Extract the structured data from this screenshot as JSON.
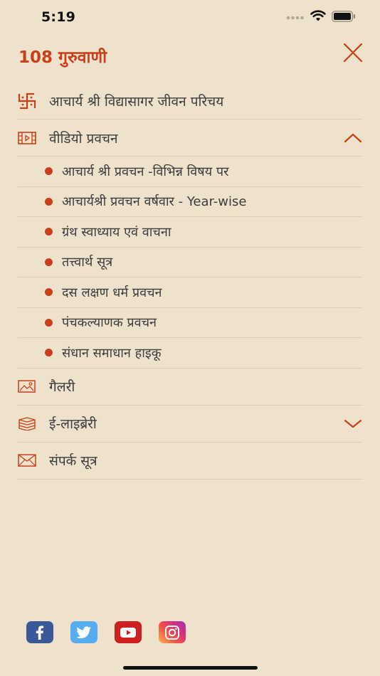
{
  "status_bar": {
    "time": "5:19"
  },
  "header": {
    "title": "108 गुरुवाणी",
    "close_icon": "close-icon"
  },
  "menu": {
    "items": [
      {
        "label": "आचार्य श्री विद्यासागर जीवन परिचय",
        "icon": "swastika-icon"
      },
      {
        "label": "वीडियो प्रवचन",
        "icon": "video-film-icon",
        "expanded": true
      },
      {
        "label": "गैलरी",
        "icon": "image-gallery-icon"
      },
      {
        "label": "ई-लाइब्रेरी",
        "icon": "books-icon",
        "expanded": false
      },
      {
        "label": "संपर्क सूत्र",
        "icon": "mail-icon"
      }
    ],
    "video_submenu": [
      "आचार्य श्री प्रवचन -विभिन्न विषय पर",
      "आचार्यश्री प्रवचन वर्षवार - Year-wise",
      "ग्रंथ स्वाध्याय एवं वाचना",
      "तत्त्वार्थ सूत्र",
      "दस लक्षण धर्म प्रवचन",
      "पंचकल्याणक प्रवचन",
      "संधान समाधान हाइकू"
    ]
  },
  "social": [
    {
      "name": "facebook",
      "icon": "facebook-icon",
      "color": "#3B5998"
    },
    {
      "name": "twitter",
      "icon": "twitter-icon",
      "color": "#55ACEE"
    },
    {
      "name": "youtube",
      "icon": "youtube-icon",
      "color": "#CD201F"
    },
    {
      "name": "instagram",
      "icon": "instagram-icon",
      "color": "#D6249F"
    }
  ],
  "colors": {
    "accent": "#C8401A",
    "background": "#EEE2CD",
    "divider": "#D9CDB6"
  }
}
